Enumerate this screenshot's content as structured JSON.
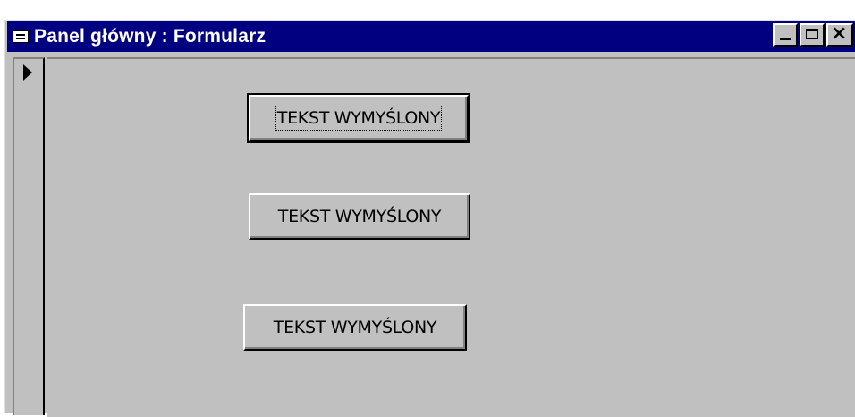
{
  "window": {
    "title": "Panel główny : Formularz",
    "controls": {
      "minimize": "minimize",
      "maximize": "maximize",
      "close": "×"
    }
  },
  "form": {
    "buttons": [
      {
        "label": "TEKST WYMYŚLONY",
        "focused": true
      },
      {
        "label": "TEKST WYMYŚLONY",
        "focused": false
      },
      {
        "label": "TEKST WYMYŚLONY",
        "focused": false
      }
    ]
  },
  "colors": {
    "titlebar": "#000080",
    "face": "#c0c0c0"
  }
}
